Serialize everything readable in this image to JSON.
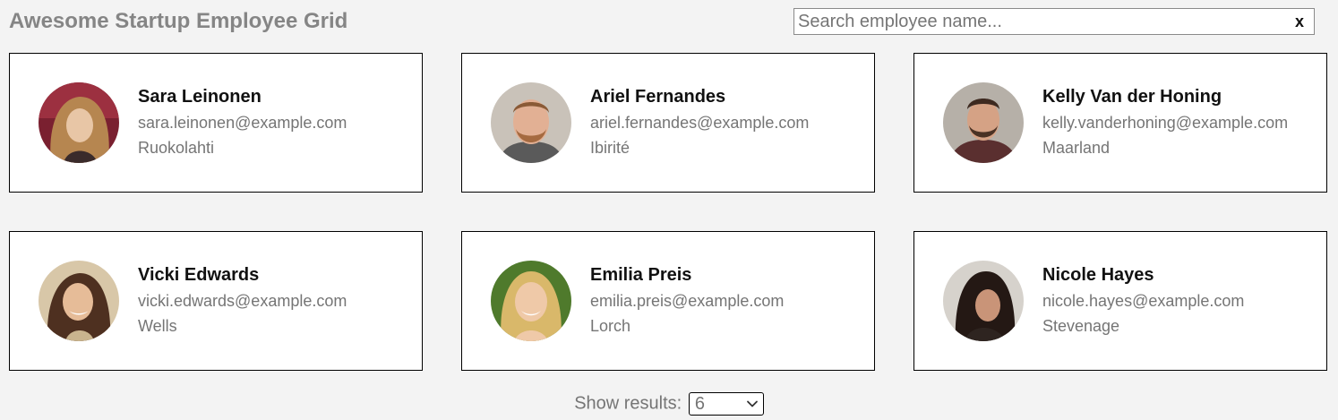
{
  "header": {
    "title": "Awesome Startup Employee Grid"
  },
  "search": {
    "placeholder": "Search employee name...",
    "value": "",
    "clear_label": "x"
  },
  "employees": [
    {
      "name": "Sara Leinonen",
      "email": "sara.leinonen@example.com",
      "city": "Ruokolahti"
    },
    {
      "name": "Ariel Fernandes",
      "email": "ariel.fernandes@example.com",
      "city": "Ibirité"
    },
    {
      "name": "Kelly Van der Honing",
      "email": "kelly.vanderhoning@example.com",
      "city": "Maarland"
    },
    {
      "name": "Vicki Edwards",
      "email": "vicki.edwards@example.com",
      "city": "Wells"
    },
    {
      "name": "Emilia Preis",
      "email": "emilia.preis@example.com",
      "city": "Lorch"
    },
    {
      "name": "Nicole Hayes",
      "email": "nicole.hayes@example.com",
      "city": "Stevenage"
    }
  ],
  "pagination": {
    "label": "Show results:",
    "selected": "6"
  },
  "colors": {
    "background": "#f3f3f3",
    "title": "#858585",
    "card_border": "#000000",
    "muted_text": "#757575"
  }
}
